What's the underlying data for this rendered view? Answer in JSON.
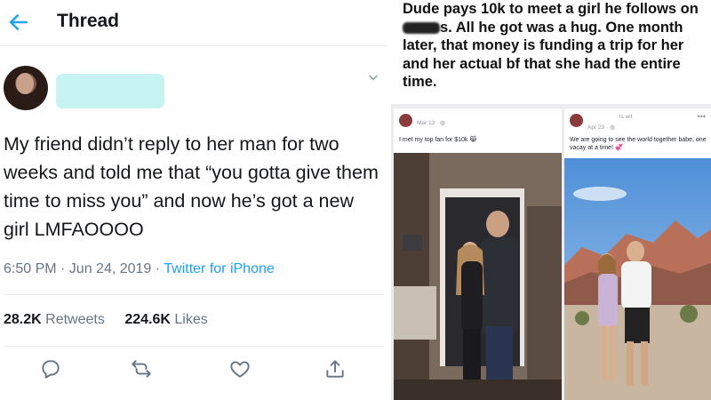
{
  "tweet": {
    "header_title": "Thread",
    "body": "My friend didn’t reply to her man for two weeks and told me that “you gotta give them time to miss you” and now he’s got a new girl LMFAOOOO",
    "time": "6:50 PM · Jun 24, 2019 · ",
    "source": "Twitter for iPhone",
    "retweets_count": "28.2K",
    "retweets_label": "Retweets",
    "likes_count": "224.6K",
    "likes_label": "Likes"
  },
  "meme": {
    "caption_part1": "Dude pays 10k to meet a girl he follows on ",
    "caption_part2": "s. All he got was a hug. One month later, that money is funding a trip for her and her actual bf that she had the entire time.",
    "post1": {
      "date": "Mar 13 · ",
      "caption": "I met my top fan for $10k 😹"
    },
    "post2": {
      "date": "Apr 23 · ",
      "with": "is wit",
      "caption": "We are going to see the world together babe, one vacay at a time! 💞"
    }
  },
  "colors": {
    "twitter_blue": "#1da1f2",
    "secondary_text": "#657786",
    "border": "#e6ecf0",
    "redaction": "#c7f3f3"
  },
  "icons": [
    "back-arrow-icon",
    "chevron-down-icon",
    "reply-icon",
    "retweet-icon",
    "like-icon",
    "share-icon"
  ]
}
